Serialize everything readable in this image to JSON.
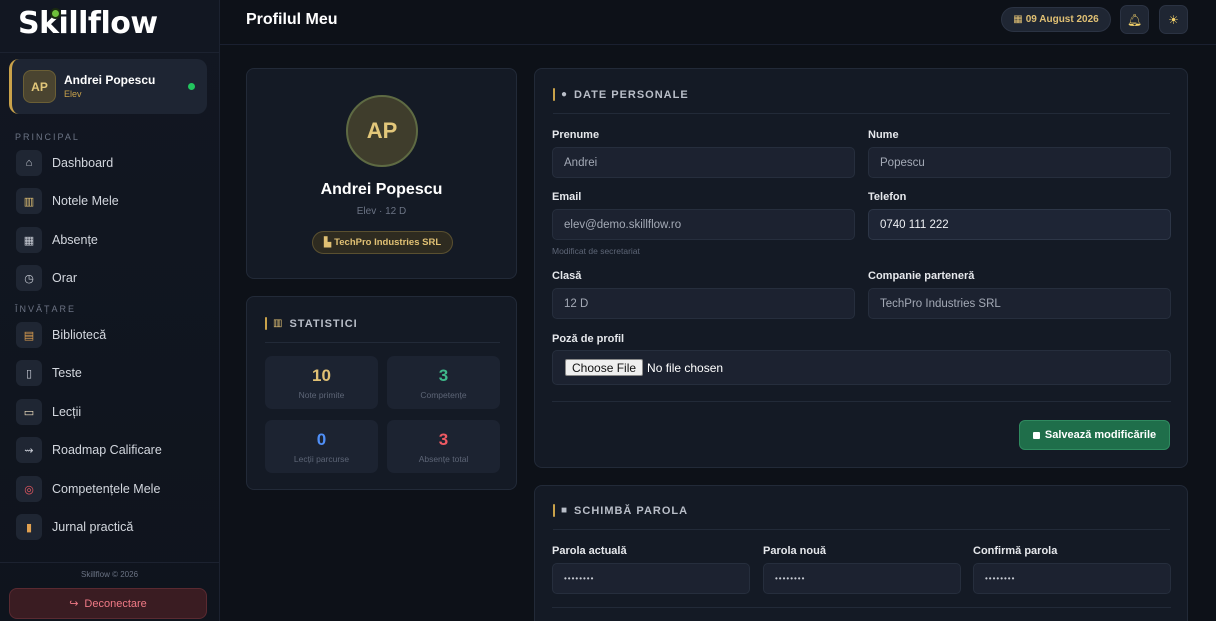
{
  "sidebar": {
    "logo": "Skillflow",
    "user": {
      "initials": "AP",
      "name": "Andrei Popescu",
      "role": "Elev"
    },
    "sections": {
      "principal": "PRINCIPAL",
      "invatare": "ÎNVĂȚARE"
    },
    "items": [
      {
        "label": "Dashboard",
        "icon": "home-icon",
        "glyph": "⌂"
      },
      {
        "label": "Notele Mele",
        "icon": "grades-chart-icon",
        "glyph": "▥"
      },
      {
        "label": "Absențe",
        "icon": "calendar-icon",
        "glyph": "▦"
      },
      {
        "label": "Orar",
        "icon": "clock-icon",
        "glyph": "◷"
      },
      {
        "label": "Bibliotecă",
        "icon": "books-icon",
        "glyph": "▤"
      },
      {
        "label": "Teste",
        "icon": "test-sheet-icon",
        "glyph": "▯"
      },
      {
        "label": "Lecții",
        "icon": "open-book-icon",
        "glyph": "▭"
      },
      {
        "label": "Roadmap Calificare",
        "icon": "map-icon",
        "glyph": "⇝"
      },
      {
        "label": "Competențele Mele",
        "icon": "target-icon",
        "glyph": "◎"
      },
      {
        "label": "Jurnal practică",
        "icon": "notebook-icon",
        "glyph": "▮"
      }
    ],
    "copyright": "Skillflow © 2026",
    "logout_label": "Deconectare"
  },
  "header": {
    "title": "Profilul Meu",
    "date": "09 August 2026"
  },
  "profile": {
    "initials": "AP",
    "name": "Andrei Popescu",
    "subtitle": "Elev · 12 D",
    "company": "TechPro Industries SRL"
  },
  "stats": {
    "title": "STATISTICI",
    "items": [
      {
        "value": "10",
        "label": "Note primite",
        "color": "#e0c074"
      },
      {
        "value": "3",
        "label": "Competențe",
        "color": "#3fb88a"
      },
      {
        "value": "0",
        "label": "Lecții parcurse",
        "color": "#4f8ff7"
      },
      {
        "value": "3",
        "label": "Absențe total",
        "color": "#ef5a63"
      }
    ]
  },
  "personal": {
    "title": "DATE PERSONALE",
    "first_name_label": "Prenume",
    "first_name": "Andrei",
    "last_name_label": "Nume",
    "last_name": "Popescu",
    "email_label": "Email",
    "email": "elev@demo.skillflow.ro",
    "email_note": "Modificat de secretariat",
    "phone_label": "Telefon",
    "phone": "0740 111 222",
    "class_label": "Clasă",
    "class": "12 D",
    "company_label": "Companie parteneră",
    "company": "TechPro Industries SRL",
    "photo_label": "Poză de profil",
    "choose_file": "Choose File",
    "no_file": "No file chosen",
    "save_label": "Salvează modificările"
  },
  "password": {
    "title": "SCHIMBĂ PAROLA",
    "current_label": "Parola actuală",
    "new_label": "Parola nouă",
    "confirm_label": "Confirmă parola",
    "masked": "••••••••"
  },
  "colors": {
    "accent_gold": "#c9a24a",
    "save_green": "#1f6e4a",
    "online": "#22c55e",
    "logout_red": "#f07a86"
  }
}
